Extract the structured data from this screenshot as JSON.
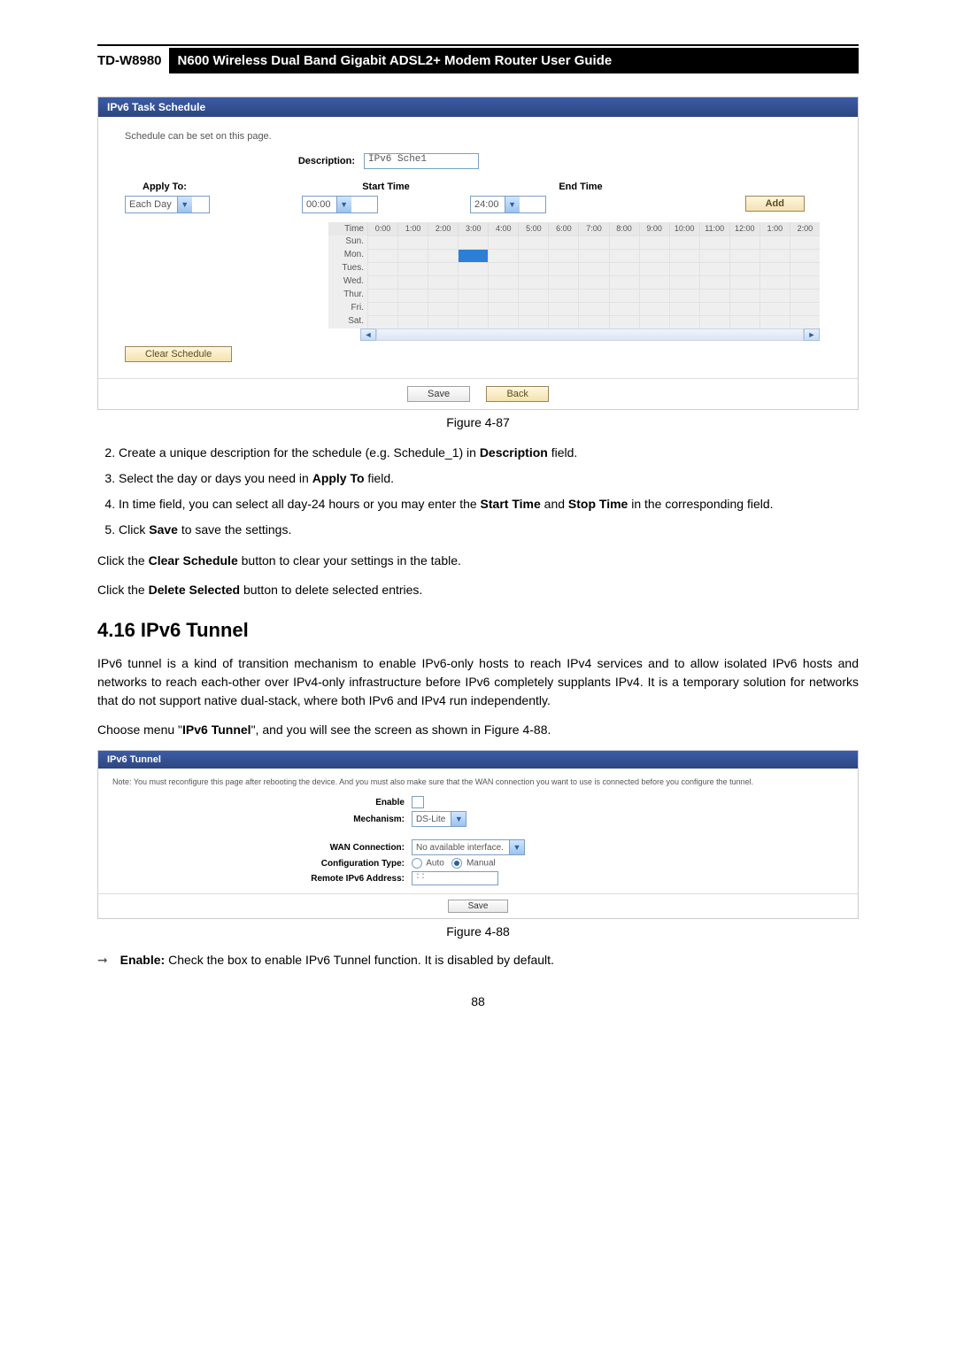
{
  "header": {
    "model": "TD-W8980",
    "title": "N600 Wireless Dual Band Gigabit ADSL2+ Modem Router User Guide"
  },
  "shot1": {
    "titlebar": "IPv6 Task Schedule",
    "intro": "Schedule can be set on this page.",
    "description_label": "Description:",
    "description_value": "IPv6 Sche1",
    "apply_label": "Apply To:",
    "apply_value": "Each Day",
    "start_label": "Start Time",
    "start_value": "00:00",
    "end_label": "End Time",
    "end_value": "24:00",
    "add_btn": "Add",
    "grid": {
      "time_label": "Time",
      "hours": [
        "0:00",
        "1:00",
        "2:00",
        "3:00",
        "4:00",
        "5:00",
        "6:00",
        "7:00",
        "8:00",
        "9:00",
        "10:00",
        "11:00",
        "12:00",
        "1:00",
        "2:00"
      ],
      "days": [
        "Sun.",
        "Mon.",
        "Tues.",
        "Wed.",
        "Thur.",
        "Fri.",
        "Sat."
      ],
      "highlight": {
        "day": 1,
        "hour": 3
      }
    },
    "clear_btn": "Clear Schedule",
    "save_btn": "Save",
    "back_btn": "Back"
  },
  "figure87": "Figure 4-87",
  "steps": {
    "s2a": "Create a unique description for the schedule (e.g. Schedule_1) in ",
    "s2b": "Description",
    "s2c": " field.",
    "s3a": "Select the day or days you need in ",
    "s3b": "Apply To",
    "s3c": " field.",
    "s4a": "In time field, you can select all day-24 hours or you may enter the ",
    "s4b": "Start Time",
    "s4c": " and ",
    "s4d": "Stop Time",
    "s4e": " in the corresponding field.",
    "s5a": "Click ",
    "s5b": "Save",
    "s5c": " to save the settings."
  },
  "para_clear_a": "Click the ",
  "para_clear_b": "Clear Schedule",
  "para_clear_c": " button to clear your settings in the table.",
  "para_delete_a": "Click the ",
  "para_delete_b": "Delete Selected",
  "para_delete_c": " button to delete selected entries.",
  "section_heading": "4.16  IPv6 Tunnel",
  "tunnel_para": "IPv6 tunnel is a kind of transition mechanism to enable IPv6-only hosts to reach IPv4 services and to allow isolated IPv6 hosts and networks to reach each-other over IPv4-only infrastructure before IPv6 completely supplants IPv4. It is a temporary solution for networks that do not support native dual-stack, where both IPv6 and IPv4 run independently.",
  "tunnel_lead_a": "Choose menu \"",
  "tunnel_lead_b": "IPv6 Tunnel",
  "tunnel_lead_c": "\", and you will see the screen as shown in Figure 4-88.",
  "shot2": {
    "titlebar": "IPv6 Tunnel",
    "note": "Note: You must reconfigure this page after rebooting the device. And you must also make sure that the WAN connection you want to use is connected before you configure the tunnel.",
    "enable_label": "Enable",
    "mechanism_label": "Mechanism:",
    "mechanism_value": "DS-Lite",
    "wan_label": "WAN Connection:",
    "wan_value": "No available interface.",
    "cfgtype_label": "Configuration Type:",
    "cfgtype_auto": "Auto",
    "cfgtype_manual": "Manual",
    "remote_label": "Remote IPv6 Address:",
    "remote_value": "::",
    "save_btn": "Save"
  },
  "figure88": "Figure 4-88",
  "enable_bullet_a": "Enable:",
  "enable_bullet_b": " Check the box to enable IPv6 Tunnel function. It is disabled by default.",
  "page_number": "88"
}
